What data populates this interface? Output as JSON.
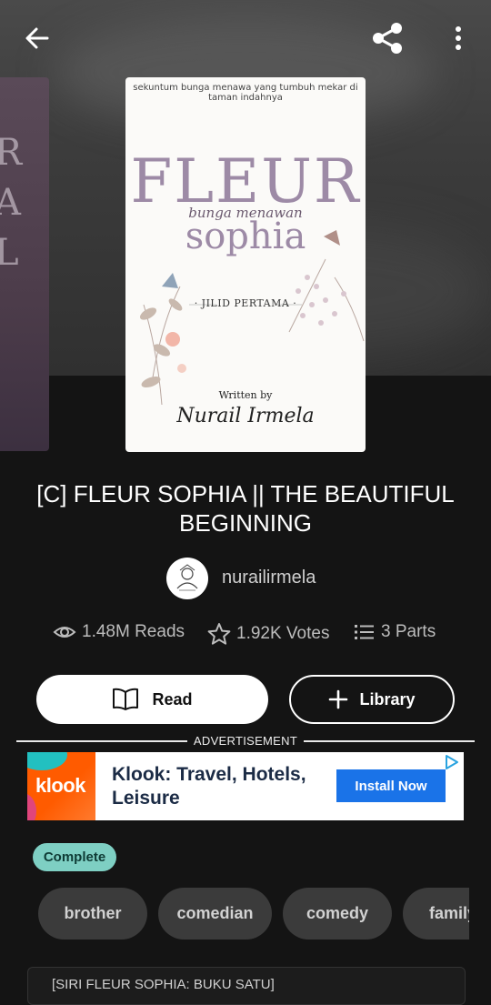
{
  "header": {
    "back_icon": "arrow-left-icon",
    "share_icon": "share-icon",
    "more_icon": "more-vertical-icon"
  },
  "adjacent_cover": {
    "letters": [
      "R",
      "A",
      "L"
    ]
  },
  "cover": {
    "tagline": "sekuntum bunga menawa yang tumbuh mekar di taman indahnya",
    "title_main": "FLEUR",
    "title_script": "bunga menawan",
    "title_sub": "sophia",
    "edition": "· JILID PERTAMA ·",
    "written_by": "Written by",
    "author_signature": "Nurail Irmela"
  },
  "story": {
    "title": "[C] FLEUR SOPHIA || THE BEAUTIFUL BEGINNING",
    "author": "nurailirmela"
  },
  "stats": {
    "reads": "1.48M Reads",
    "votes": "1.92K Votes",
    "parts": "3 Parts"
  },
  "actions": {
    "read_label": "Read",
    "library_label": "Library"
  },
  "ad": {
    "label": "ADVERTISEMENT",
    "brand": "klook",
    "headline": "Klook: Travel, Hotels, Leisure",
    "cta": "Install Now"
  },
  "status_badge": "Complete",
  "tags": [
    "brother",
    "comedian",
    "comedy",
    "family"
  ],
  "description_preview": "[SIRI FLEUR SOPHIA: BUKU SATU]",
  "colors": {
    "background": "#141414",
    "badge": "#7ecfc3",
    "tag_bg": "#3b3b3b",
    "ad_cta": "#1a73e8",
    "cover_title": "#9d8aa6"
  }
}
